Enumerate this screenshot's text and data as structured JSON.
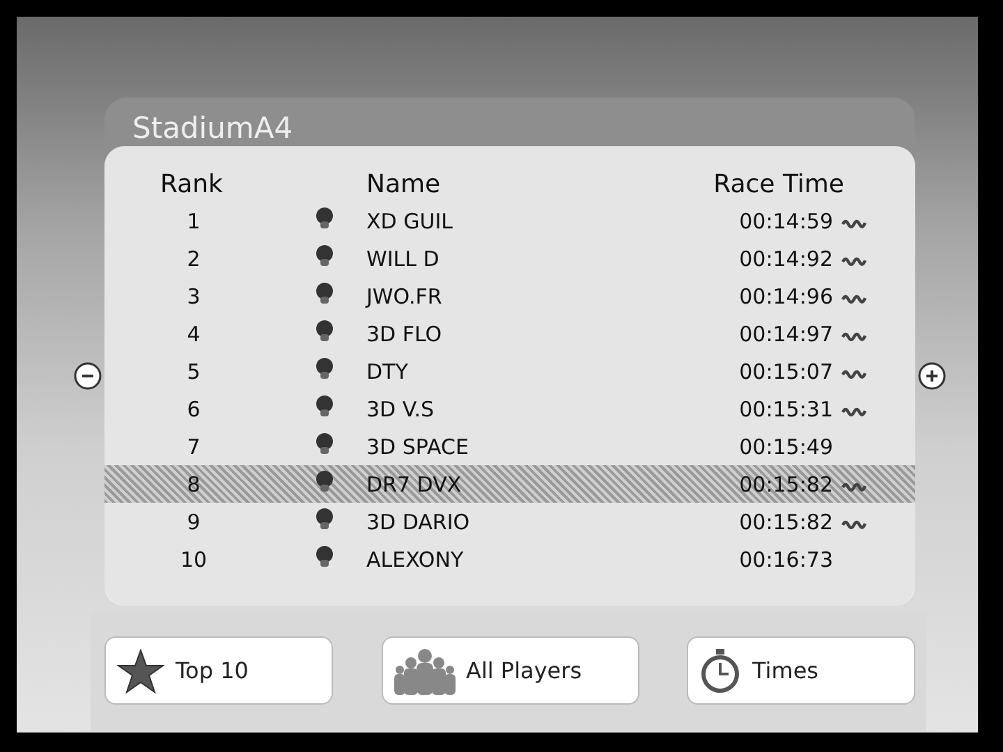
{
  "panel": {
    "title": "StadiumA4"
  },
  "table": {
    "columns": [
      "Rank",
      "Name",
      "Race Time"
    ],
    "rows": [
      {
        "rank": "1",
        "name": "XD GUIL",
        "time": "00:14:59",
        "wheel": true,
        "selected": false
      },
      {
        "rank": "2",
        "name": "WILL D",
        "time": "00:14:92",
        "wheel": true,
        "selected": false
      },
      {
        "rank": "3",
        "name": "JWO.FR",
        "time": "00:14:96",
        "wheel": true,
        "selected": false
      },
      {
        "rank": "4",
        "name": "3D FLO",
        "time": "00:14:97",
        "wheel": true,
        "selected": false
      },
      {
        "rank": "5",
        "name": "DTY",
        "time": "00:15:07",
        "wheel": true,
        "selected": false
      },
      {
        "rank": "6",
        "name": "3D V.S",
        "time": "00:15:31",
        "wheel": true,
        "selected": false
      },
      {
        "rank": "7",
        "name": "3D SPACE",
        "time": "00:15:49",
        "wheel": false,
        "selected": false
      },
      {
        "rank": "8",
        "name": "DR7 DVX",
        "time": "00:15:82",
        "wheel": true,
        "selected": true
      },
      {
        "rank": "9",
        "name": "3D DARIO",
        "time": "00:15:82",
        "wheel": true,
        "selected": false
      },
      {
        "rank": "10",
        "name": "ALEXONY",
        "time": "00:16:73",
        "wheel": false,
        "selected": false
      }
    ]
  },
  "buttons": [
    {
      "kind": "star",
      "label": "Top 10"
    },
    {
      "kind": "people",
      "label": "All Players"
    },
    {
      "kind": "clock",
      "label": "Times"
    }
  ]
}
